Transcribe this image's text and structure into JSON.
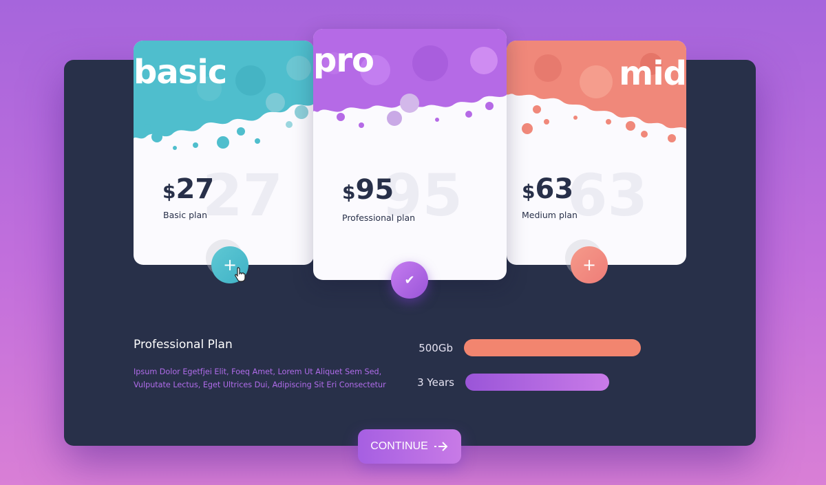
{
  "cards": {
    "basic": {
      "word": "basic",
      "price_currency": "$",
      "price_amount": "27",
      "ghost": "27",
      "subtitle": "Basic plan",
      "action_icon": "plus-icon",
      "action_glyph": "+",
      "color": "#4fbecd"
    },
    "pro": {
      "word": "pro",
      "price_currency": "$",
      "price_amount": "95",
      "ghost": "95",
      "subtitle": "Professional plan",
      "action_icon": "check-icon",
      "action_glyph": "✔",
      "color": "#b56ae6"
    },
    "mid": {
      "word": "mid",
      "price_currency": "$",
      "price_amount": "63",
      "ghost": "63",
      "subtitle": "Medium plan",
      "action_icon": "plus-icon",
      "action_glyph": "+",
      "color": "#f0887a"
    }
  },
  "details": {
    "title": "Professional Plan",
    "description": "Ipsum Dolor Egetfjei Elit, Foeq Amet, Lorem Ut Aliquet Sem Sed, Vulputate Lectus, Eget Ultrices Dui, Adipiscing Sit Eri Consectetur"
  },
  "features": [
    {
      "label": "500Gb",
      "color": "#f2856f"
    },
    {
      "label": "3 Years",
      "color": "#a65fe2"
    }
  ],
  "continue_button": {
    "label": "CONTINUE",
    "icon": "arrow-right-icon"
  },
  "colors": {
    "panel": "#283049",
    "background": "#b56ae0"
  }
}
